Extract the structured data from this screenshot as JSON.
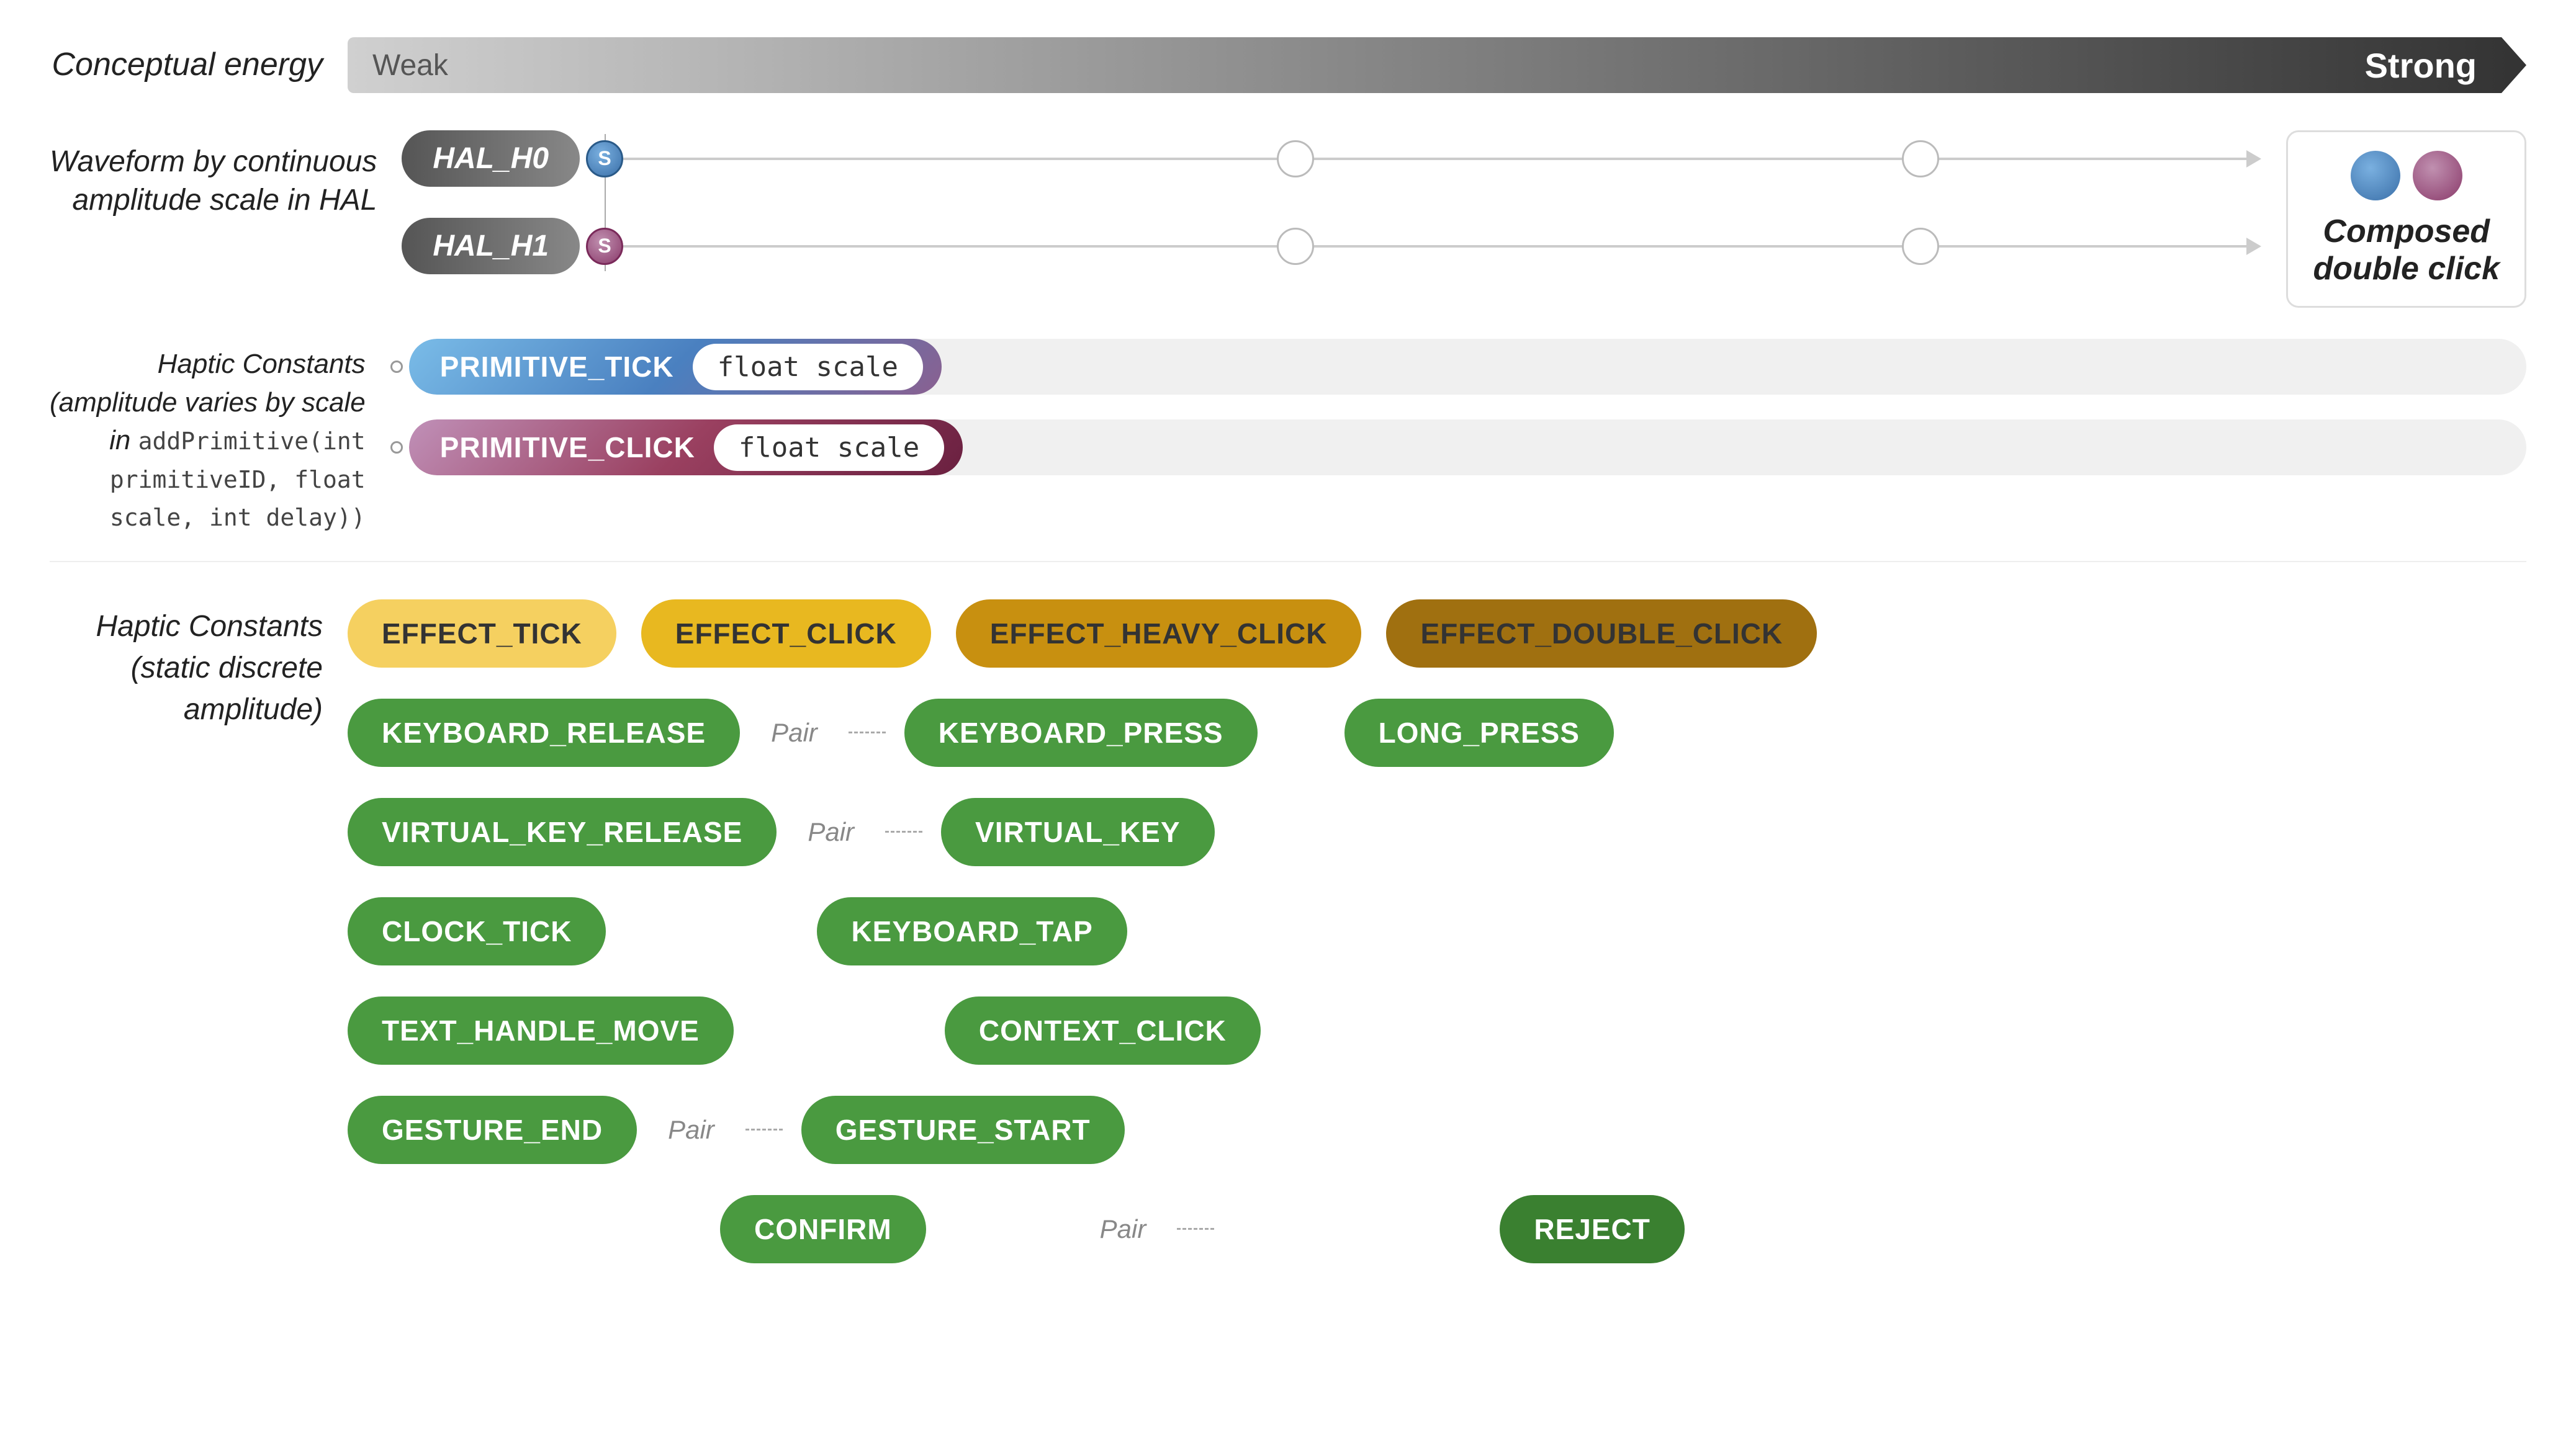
{
  "energy": {
    "label": "Conceptual energy",
    "weak": "Weak",
    "strong": "Strong"
  },
  "waveform": {
    "label": "Waveform by continuous\namplitude scale in HAL",
    "hal_h0": "HAL_H0",
    "hal_h1": "HAL_H1"
  },
  "composed_legend": {
    "text_line1": "Composed",
    "text_line2": "double click"
  },
  "primitives": {
    "label_line1": "Haptic Constants",
    "label_line2": "(amplitude varies by scale",
    "label_line3": "in addPrimitive(int",
    "label_line4": "primitiveID, float",
    "label_line5": "scale, int delay))",
    "primitive_tick_name": "PRIMITIVE_TICK",
    "primitive_tick_param": "float scale",
    "primitive_click_name": "PRIMITIVE_CLICK",
    "primitive_click_param": "float scale"
  },
  "constants": {
    "label_line1": "Haptic Constants",
    "label_line2": "(static discrete",
    "label_line3": "amplitude)",
    "effects": {
      "effect_tick": "EFFECT_TICK",
      "effect_click": "EFFECT_CLICK",
      "effect_heavy_click": "EFFECT_HEAVY_CLICK",
      "effect_double_click": "EFFECT_DOUBLE_CLICK"
    },
    "buttons": {
      "keyboard_release": "KEYBOARD_RELEASE",
      "keyboard_press": "KEYBOARD_PRESS",
      "long_press": "LONG_PRESS",
      "virtual_key_release": "VIRTUAL_KEY_RELEASE",
      "virtual_key": "VIRTUAL_KEY",
      "clock_tick": "CLOCK_TICK",
      "keyboard_tap": "KEYBOARD_TAP",
      "text_handle_move": "TEXT_HANDLE_MOVE",
      "context_click": "CONTEXT_CLICK",
      "gesture_end": "GESTURE_END",
      "gesture_start": "GESTURE_START",
      "confirm": "CONFIRM",
      "reject": "REJECT"
    },
    "pair_label": "Pair",
    "pair_label2": "Pair",
    "pair_label3": "Pair",
    "pair_label4": "Pair"
  },
  "colors": {
    "yellow_light": "#f5d060",
    "yellow_mid": "#e8b820",
    "yellow_dark": "#c89010",
    "green": "#4a9a40",
    "green_dark": "#3a8030"
  }
}
